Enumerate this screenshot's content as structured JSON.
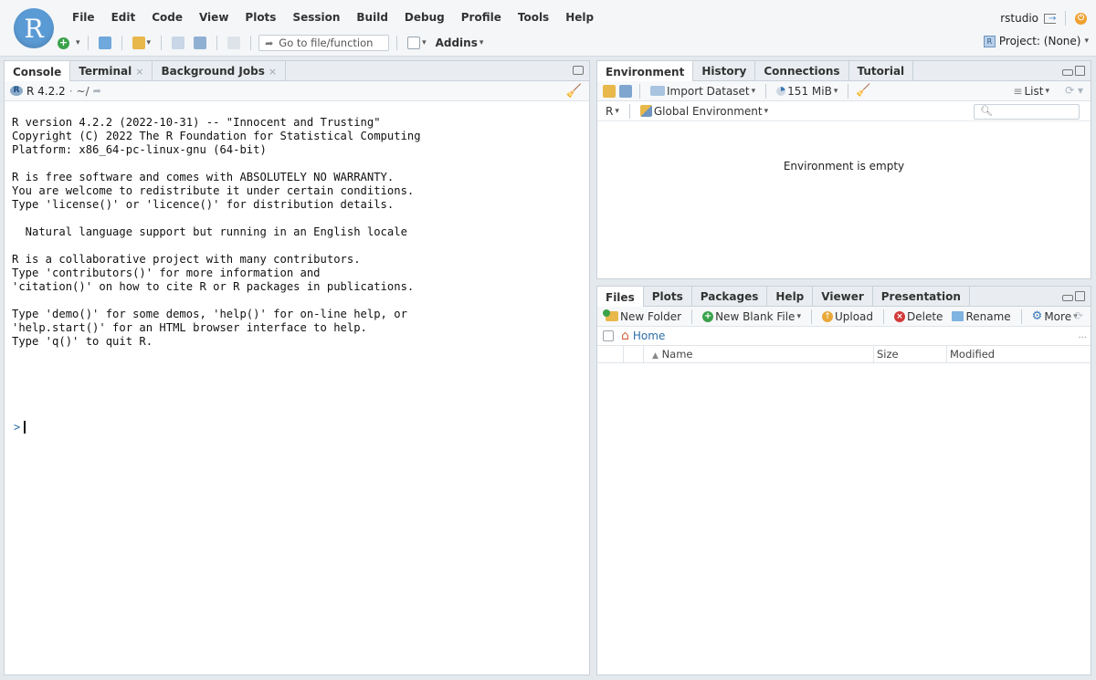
{
  "app": {
    "logo_letter": "R",
    "user": "rstudio",
    "project_label": "Project: (None)"
  },
  "menu": [
    "File",
    "Edit",
    "Code",
    "View",
    "Plots",
    "Session",
    "Build",
    "Debug",
    "Profile",
    "Tools",
    "Help"
  ],
  "toolbar": {
    "goto_placeholder": "Go to file/function",
    "addins_label": "Addins"
  },
  "console_panel": {
    "tabs": [
      {
        "label": "Console",
        "active": true,
        "closable": false
      },
      {
        "label": "Terminal",
        "active": false,
        "closable": true
      },
      {
        "label": "Background Jobs",
        "active": false,
        "closable": true
      }
    ],
    "version_label": "R 4.2.2",
    "path_label": "~/",
    "output": "R version 4.2.2 (2022-10-31) -- \"Innocent and Trusting\"\nCopyright (C) 2022 The R Foundation for Statistical Computing\nPlatform: x86_64-pc-linux-gnu (64-bit)\n\nR is free software and comes with ABSOLUTELY NO WARRANTY.\nYou are welcome to redistribute it under certain conditions.\nType 'license()' or 'licence()' for distribution details.\n\n  Natural language support but running in an English locale\n\nR is a collaborative project with many contributors.\nType 'contributors()' for more information and\n'citation()' on how to cite R or R packages in publications.\n\nType 'demo()' for some demos, 'help()' for on-line help, or\n'help.start()' for an HTML browser interface to help.\nType 'q()' to quit R.",
    "prompt": ">"
  },
  "env_panel": {
    "tabs": [
      "Environment",
      "History",
      "Connections",
      "Tutorial"
    ],
    "import_label": "Import Dataset",
    "memory_label": "151 MiB",
    "list_label": "List",
    "lang_label": "R",
    "scope_label": "Global Environment",
    "empty_message": "Environment is empty"
  },
  "files_panel": {
    "tabs": [
      "Files",
      "Plots",
      "Packages",
      "Help",
      "Viewer",
      "Presentation"
    ],
    "actions": {
      "new_folder": "New Folder",
      "new_blank_file": "New Blank File",
      "upload": "Upload",
      "delete": "Delete",
      "rename": "Rename",
      "more": "More"
    },
    "breadcrumb": "Home",
    "columns": {
      "name": "Name",
      "size": "Size",
      "modified": "Modified"
    },
    "more_dots": "..."
  },
  "colors": {
    "accent": "#5b9bd5",
    "tab_bg": "#e9edf1",
    "chrome": "#f4f6f8"
  }
}
